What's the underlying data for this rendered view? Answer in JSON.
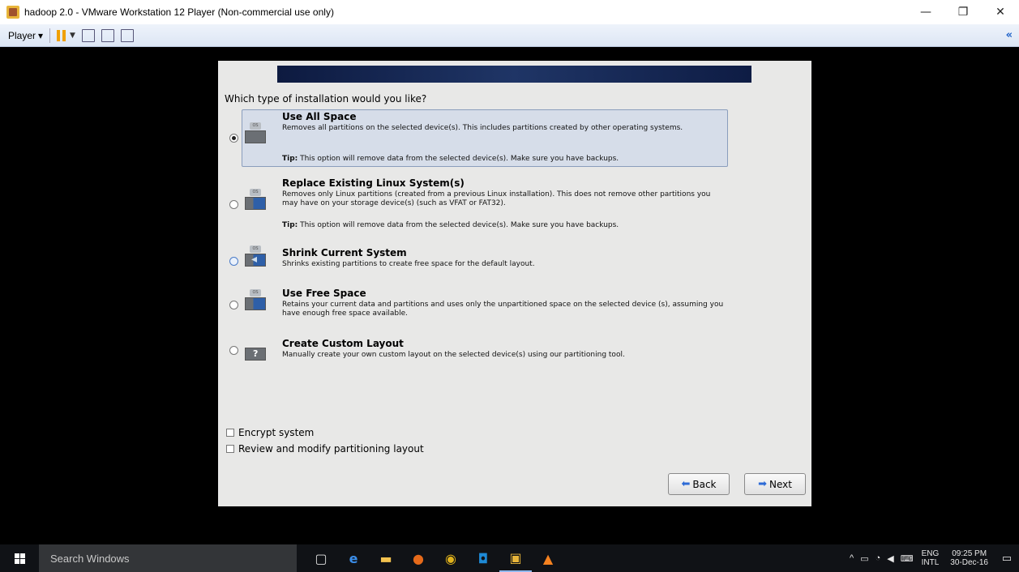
{
  "window": {
    "title": "hadoop 2.0 - VMware Workstation 12 Player (Non-commercial use only)",
    "minimize": "—",
    "restore": "❐",
    "close": "✕"
  },
  "toolbar": {
    "player_label": "Player",
    "player_arrow": "▾",
    "collapse": "«"
  },
  "installer": {
    "question": "Which type of installation would you like?",
    "options": [
      {
        "title": "Use All Space",
        "description": "Removes all partitions on the selected device(s).  This includes partitions created by other operating systems.",
        "tip_label": "Tip:",
        "tip": " This option will remove data from the selected device(s).  Make sure you have backups.",
        "selected": true,
        "icon": "os-disk-icon"
      },
      {
        "title": "Replace Existing Linux System(s)",
        "description": "Removes only Linux partitions (created from a previous Linux installation).  This does not remove other partitions you may have on your storage device(s) (such as VFAT or FAT32).",
        "tip_label": "Tip:",
        "tip": " This option will remove data from the selected device(s).  Make sure you have backups.",
        "selected": false,
        "icon": "replace-linux-icon"
      },
      {
        "title": "Shrink Current System",
        "description": "Shrinks existing partitions to create free space for the default layout.",
        "selected": false,
        "icon": "shrink-icon"
      },
      {
        "title": "Use Free Space",
        "description": "Retains your current data and partitions and uses only the unpartitioned space on the selected device (s), assuming you have enough free space available.",
        "selected": false,
        "icon": "free-space-icon"
      },
      {
        "title": "Create Custom Layout",
        "description": "Manually create your own custom layout on the selected device(s) using our partitioning tool.",
        "selected": false,
        "icon": "custom-layout-icon"
      }
    ],
    "os_tag": "OS",
    "encrypt_label": "Encrypt system",
    "review_label": "Review and modify partitioning layout",
    "back_label": "Back",
    "next_label": "Next"
  },
  "taskbar": {
    "search_placeholder": "Search Windows",
    "tray_up": "^",
    "language_top": "ENG",
    "language_bottom": "INTL",
    "time": "09:25 PM",
    "date": "30-Dec-16"
  }
}
